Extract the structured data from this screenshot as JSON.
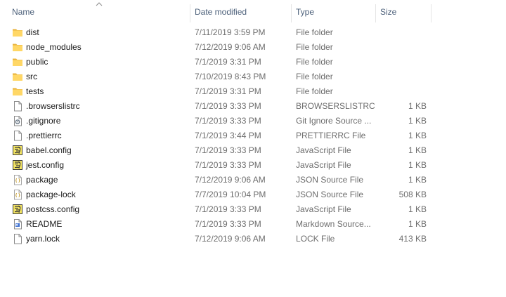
{
  "columns": {
    "name": "Name",
    "date_modified": "Date modified",
    "type": "Type",
    "size": "Size"
  },
  "files": [
    {
      "name": "dist",
      "date": "7/11/2019 3:59 PM",
      "type": "File folder",
      "size": "",
      "icon": "folder-icon"
    },
    {
      "name": "node_modules",
      "date": "7/12/2019 9:06 AM",
      "type": "File folder",
      "size": "",
      "icon": "folder-icon"
    },
    {
      "name": "public",
      "date": "7/1/2019 3:31 PM",
      "type": "File folder",
      "size": "",
      "icon": "folder-icon"
    },
    {
      "name": "src",
      "date": "7/10/2019 8:43 PM",
      "type": "File folder",
      "size": "",
      "icon": "folder-icon"
    },
    {
      "name": "tests",
      "date": "7/1/2019 3:31 PM",
      "type": "File folder",
      "size": "",
      "icon": "folder-icon"
    },
    {
      "name": ".browserslistrc",
      "date": "7/1/2019 3:33 PM",
      "type": "BROWSERSLISTRC...",
      "size": "1 KB",
      "icon": "blank-file-icon"
    },
    {
      "name": ".gitignore",
      "date": "7/1/2019 3:33 PM",
      "type": "Git Ignore Source ...",
      "size": "1 KB",
      "icon": "settings-file-icon"
    },
    {
      "name": ".prettierrc",
      "date": "7/1/2019 3:44 PM",
      "type": "PRETTIERRC File",
      "size": "1 KB",
      "icon": "blank-file-icon"
    },
    {
      "name": "babel.config",
      "date": "7/1/2019 3:33 PM",
      "type": "JavaScript File",
      "size": "1 KB",
      "icon": "javascript-file-icon"
    },
    {
      "name": "jest.config",
      "date": "7/1/2019 3:33 PM",
      "type": "JavaScript File",
      "size": "1 KB",
      "icon": "javascript-file-icon"
    },
    {
      "name": "package",
      "date": "7/12/2019 9:06 AM",
      "type": "JSON Source File",
      "size": "1 KB",
      "icon": "json-file-icon"
    },
    {
      "name": "package-lock",
      "date": "7/7/2019 10:04 PM",
      "type": "JSON Source File",
      "size": "508 KB",
      "icon": "json-file-icon"
    },
    {
      "name": "postcss.config",
      "date": "7/1/2019 3:33 PM",
      "type": "JavaScript File",
      "size": "1 KB",
      "icon": "javascript-file-icon"
    },
    {
      "name": "README",
      "date": "7/1/2019 3:33 PM",
      "type": "Markdown Source...",
      "size": "1 KB",
      "icon": "markdown-file-icon"
    },
    {
      "name": "yarn.lock",
      "date": "7/12/2019 9:06 AM",
      "type": "LOCK File",
      "size": "413 KB",
      "icon": "blank-file-icon"
    }
  ],
  "colors": {
    "header_text": "#4c607a",
    "folder_yellow": "#ffd766",
    "folder_dark": "#e8b13a",
    "secondary_text": "#6d6d6d"
  }
}
